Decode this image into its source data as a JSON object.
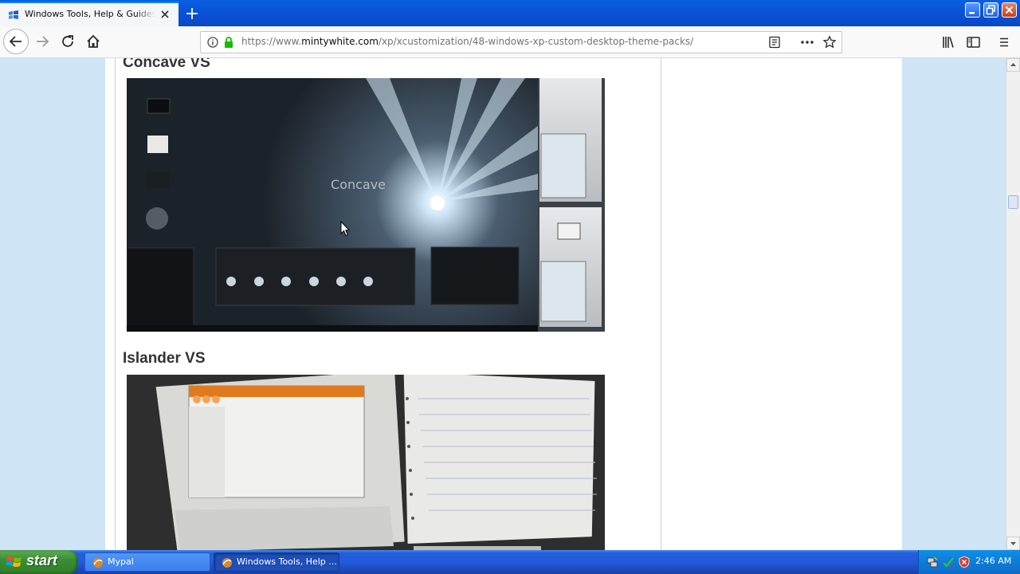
{
  "browser": {
    "tab_title": "Windows Tools, Help & Guides » Bl",
    "url_prefix": "https://www.",
    "url_domain": "mintywhite.com",
    "url_path": "/xp/xcustomization/48-windows-xp-custom-desktop-theme-packs/"
  },
  "article": {
    "sections": [
      {
        "heading": "Concave VS",
        "preview_logo": "Concave"
      },
      {
        "heading": "Islander VS"
      }
    ]
  },
  "taskbar": {
    "start_label": "start",
    "tasks": [
      {
        "label": "Mypal"
      },
      {
        "label": "Windows Tools, Help ..."
      }
    ],
    "clock": "2:46 AM"
  },
  "colors": {
    "xp_blue": "#245edb",
    "start_green": "#3c8f35",
    "firefox_accent": "#0a84ff",
    "page_bg": "#cfe4f5"
  },
  "icons": [
    "browser-favicon",
    "tab-close-icon",
    "new-tab-icon",
    "back-arrow-icon",
    "forward-arrow-icon",
    "reload-icon",
    "home-icon",
    "info-icon",
    "lock-icon",
    "reader-view-icon",
    "page-actions-icon",
    "bookmark-star-icon",
    "library-icon",
    "sidebar-icon",
    "hamburger-menu-icon",
    "windows-flag-icon"
  ]
}
